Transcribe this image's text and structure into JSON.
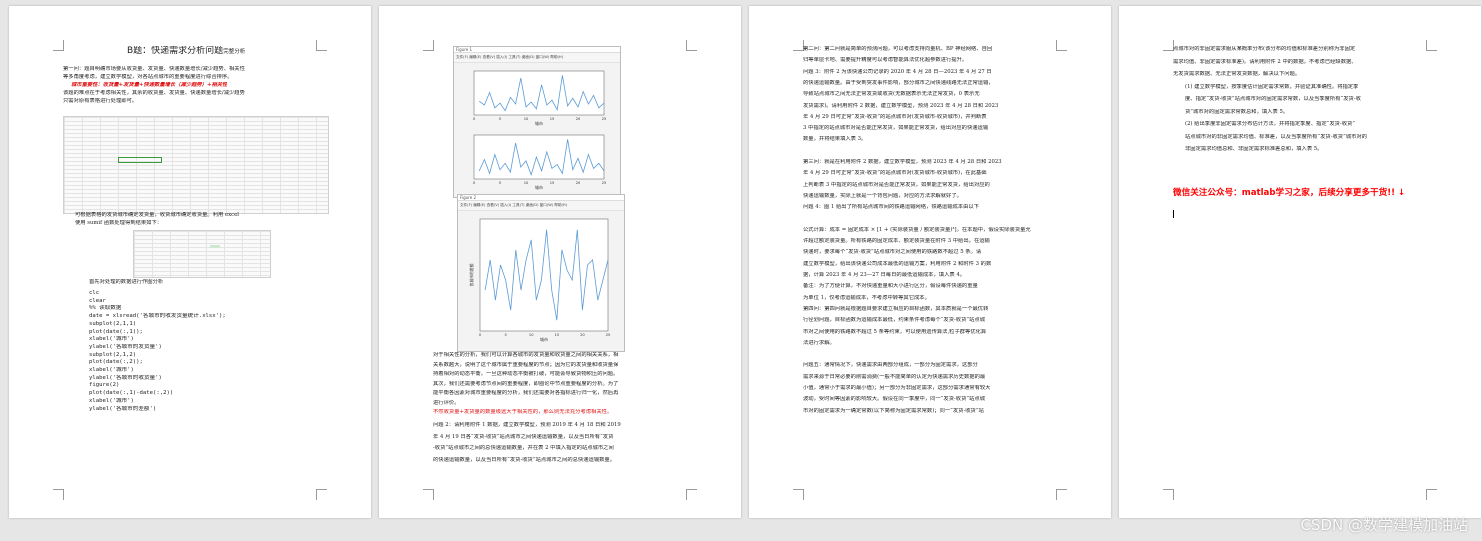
{
  "page1": {
    "title": "B题：快递需求分析问题",
    "title_suffix": "完整分析",
    "lines": [
      "第一问：题目明确市场要从收货量、发货量、快递数量增长/减少趋势、相关性",
      "等多角度考虑，建立数学模型，对各站点城市的重要程度进行综合排序。",
      "该题的难点在于考虑相关性，其余的收货量、发货量、快递数量增长/减少趋势",
      "只需对原有表格进行处理即可。"
    ],
    "red_line": "城市重要性：收货量+发货量+快递数量增长（减少趋势）+相关性",
    "after_sheet": [
      "可根据表格的发货城市确定发货量，收货城市确定收货量。利用 excel",
      "使用 sumif 函数处理得到结果如下："
    ],
    "code_intro": "首先对处理的数据进行作图分析",
    "code": [
      "clc",
      "clear",
      "%% 读取数据",
      "date = xlsread('各城市的收发货量统计.xlsx');",
      "subplot(2,1,1)",
      "plot(date(:,1));",
      "xlabel('城市')",
      "ylabel('各城市的发货量')",
      "subplot(2,1,2)",
      "plot(date(:,2));",
      "xlabel('城市')",
      "ylabel('各城市的收货量')",
      "figure(2)",
      "plot(date(:,1)-date(:,2))",
      "xlabel('城市')",
      "ylabel('各城市的差额')"
    ]
  },
  "page2": {
    "figure1": {
      "title": "Figure 1",
      "menu": "文件(F)  编辑(E)  查看(V)  插入(I)  工具(T)  桌面(D)  窗口(W)  帮助(H)"
    },
    "figure2": {
      "title": "Figure 2",
      "menu": "文件(F)  编辑(E)  查看(V)  插入(I)  工具(T)  桌面(D)  窗口(W)  帮助(H)"
    },
    "text": [
      "对于相关性的分析，我们可以计算各城市的发货量和收货量之间的相关关系，相",
      "关系数越大，说明了这个城市属于重要程度的节点；因为它的发货量和收货量保",
      "持着相对的动态平衡，一旦这种动态平衡被打破，可能会导致货物积压的问题。",
      "其次，我们还需要考虑节点间的重要程度，即圈论中节点重要程度的分析。为了",
      "能平衡各因素对城市重要程度的分析，我们还需要对各指标进行归一化，然后再",
      "进行评价。"
    ],
    "text_red": "不然收货量+发货量的数量级远大于相关性的，那么则无法充分考虑相关性。",
    "q2": [
      "问题 2：请利用附件 1 数据，建立数学模型，预测 2019 年 4 月 18 日和 2019",
      "年 4 月 19 日各“发货-收货”站点城市之间快递运输数量，以及当日所有“发货",
      "-收货”站点城市之间的总快递运输数量，并在表 2 中填入指定的站点城市之间",
      "的快递运输数量，以及当日所有“发货-收货”站点城市之间的总快递运输数量。"
    ]
  },
  "page3": {
    "lines": [
      "第二问：第二问就是简单的预测问题，可以考虑支持向量机、BP 神经网络、自回",
      "归等单层卡地、需要提升精度可以考虑智能算法优化超参数进行提升。",
      "问题 3：附件 2 为该快递公司记录的 2020 年 4 月 28 日—2023 年 4 月 27 日",
      "的快递运输数量。由于受到突发事件影响，部分城市之间快递线路无法正常运输，",
      "导致站点城市之间无法正常发货或收货(无数据表示无法正常发货，0 表示无",
      "发货需求)。请利用附件 2 数据，建立数学模型，预测 2023 年 4 月 28 日和 2023",
      "年 4 月 29 日可正常“发货-收货”的站点城市对(发货城市-收货城市)，并判断表",
      "3 中指定的站点城市对是否能正常发货，如果能正常发货，给出对应的快递运输",
      "数量，并将结果填入表 3。",
      "",
      "第三问：就是在利用附件 2 数据，建立数学模型，预测 2023 年 4 月 28 日和 2023",
      "年 4 月 29 日可正常“发货-收货”的站点城市对(发货城市-收货城市)，在此基础",
      "上判断表 3 中指定的站点城市对是否能正常发货，如果能正常发货，给出对应的",
      "快递运输数量，实际上就是一个背包问题，对应的方法求解就好了。",
      "问题 4：图 1 给出了所有站点城市间的铁路运输网络，铁路运输成本由以下",
      "",
      "公式计算：成本 = 固定成本 × [1 + (实际装货量 / 额定装货量)³]，在本题中，假设实际装货量允",
      "许超过额定装货量。所有铁路的固定成本、额定装货量在附件 3 中给出。在运输",
      "快递时，要求每个“发货-收货”站点城市对之间使用的铁路数不超过 5 条。请",
      "建立数学模型，给出该快递公司成本最低的运输方案，利用附件 2 和附件 3 的数",
      "据，计算 2023 年 4 月 23—27 日每日的最低运输成本，填入表 4。",
      "备注：为了方便计算，不对快递重量和大小进行区分，假设每件快递的重量",
      "为单位 1，仅考虑运输成本，不考虑中转等其它成本。",
      "第四问：第四问就是根据题目要求建立相应的目标函数，其本质就是一个最优转",
      "行径划问题，目标函数为运输成本最低，约束条件考虑每个“发货-收货”站点城",
      "市对之间使用的铁路数不超过 5 条等约束，可以使用遗传算法,粒子群等优化算",
      "法进行求解。",
      "",
      "问题五：通常情况下，快递需求由两部分组成，一部分为固定需求，这部分",
      "需求来源于日常必要的刚需消费(一般不能简单的认定为快递需求历史数据的最",
      "小值，通常小于需求的最小值)；另一部分为非固定需求，这部分需求通常有较大",
      "波动，受时间等因素的影响较大。假设在同一季度中，同一“发货-收货”站点城",
      "市对的固定需求为一确定常数(以下简称为固定需求常数)；同一“发货-收货”站"
    ]
  },
  "page4": {
    "lines": [
      "点城市对的非固定需求服从某概率分布(该分布的均值和标准差分别称为非固定",
      "需求均值、非固定需求标准差)。请利用附件 2 中的数据，不考虑已经缺数据、",
      "无发货需求数据、无法正常发货数据，解决以下问题。",
      "(1) 建立数学模型，按季度估计固定需求常数，并验证其准确性。将指定季",
      "度、指定“发货-收货”站点城市对的固定需求常数，以及当季度所有“发货-收",
      "货”城市对的固定需求常数总和，填入表 5。",
      "(2) 给出季度非固定需求分布估计方法，并将指定季度、指定“发货-收货”",
      "站点城市对的非固定需求均值、标准差，以及当季度所有“发货-收货”城市对的",
      "非固定需求均值总和、非固定需求标准差总和，填入表 5。"
    ],
    "slogan": "微信关注公众号：matlab学习之家，后续分享更多干货!! ↓"
  },
  "watermark": "CSDN @数学建模加油站",
  "chart_data": [
    {
      "type": "line",
      "title": "",
      "xlabel": "城市",
      "ylabel": "",
      "xlim": [
        0,
        25
      ],
      "x": [
        1,
        2,
        3,
        4,
        5,
        6,
        7,
        8,
        9,
        10,
        11,
        12,
        13,
        14,
        15,
        16,
        17,
        18,
        19,
        20,
        21,
        22,
        23,
        24,
        25
      ],
      "series": [
        {
          "values": [
            3.2,
            2.8,
            4.1,
            2.5,
            3.0,
            2.2,
            3.6,
            2.9,
            5.6,
            2.6,
            3.1,
            2.4,
            4.9,
            2.8,
            3.3,
            2.3,
            5.9,
            2.7,
            3.5,
            2.6,
            4.2,
            2.9,
            3.8,
            2.5,
            3.0
          ]
        }
      ],
      "color": "#5b9bd5"
    },
    {
      "type": "line",
      "title": "",
      "xlabel": "城市",
      "ylabel": "",
      "xlim": [
        0,
        25
      ],
      "x": [
        1,
        2,
        3,
        4,
        5,
        6,
        7,
        8,
        9,
        10,
        11,
        12,
        13,
        14,
        15,
        16,
        17,
        18,
        19,
        20,
        21,
        22,
        23,
        24,
        25
      ],
      "series": [
        {
          "values": [
            2.6,
            3.5,
            2.4,
            3.9,
            2.7,
            3.2,
            2.5,
            4.8,
            2.9,
            3.4,
            2.3,
            3.7,
            2.6,
            4.1,
            2.8,
            3.1,
            2.4,
            5.1,
            2.7,
            3.6,
            2.5,
            3.9,
            2.8,
            3.2,
            2.6
          ]
        }
      ],
      "color": "#5b9bd5"
    },
    {
      "type": "line",
      "title": "",
      "xlabel": "城市",
      "ylabel": "各城市的差额",
      "xlim": [
        0,
        25
      ],
      "x": [
        1,
        2,
        3,
        4,
        5,
        6,
        7,
        8,
        9,
        10,
        11,
        12,
        13,
        14,
        15,
        16,
        17,
        18,
        19,
        20,
        21,
        22,
        23,
        24,
        25
      ],
      "series": [
        {
          "values": [
            -2,
            1,
            -3,
            0.5,
            -1,
            -4,
            2,
            -2,
            1,
            3,
            -3,
            -1,
            4,
            -2,
            -5,
            2,
            0,
            -1,
            4,
            -4,
            0.5,
            1,
            -3,
            -1,
            1
          ]
        }
      ],
      "color": "#5b9bd5"
    }
  ]
}
